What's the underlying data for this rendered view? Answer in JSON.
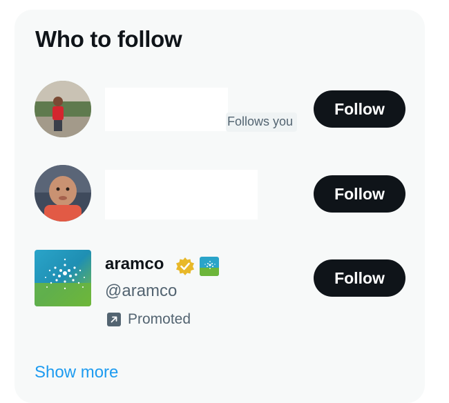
{
  "widget": {
    "title": "Who to follow",
    "show_more_label": "Show more"
  },
  "suggestions": [
    {
      "name": "",
      "handle": "",
      "badge": "Follows you",
      "follow_label": "Follow",
      "avatar_icon": "user-photo-avatar"
    },
    {
      "name": "",
      "handle": "",
      "follow_label": "Follow",
      "avatar_icon": "user-photo-avatar"
    },
    {
      "name": "aramco",
      "handle": "@aramco",
      "promoted_label": "Promoted",
      "follow_label": "Follow",
      "avatar_icon": "aramco-logo",
      "verified_icon": "gold-verified-badge-icon",
      "affiliate_icon": "aramco-affiliate-badge-icon"
    }
  ],
  "colors": {
    "panel_bg": "#f7f9f9",
    "button_bg": "#0f1419",
    "secondary_text": "#536471",
    "link": "#1d9bf0",
    "verified_gold": "#e8b829"
  }
}
